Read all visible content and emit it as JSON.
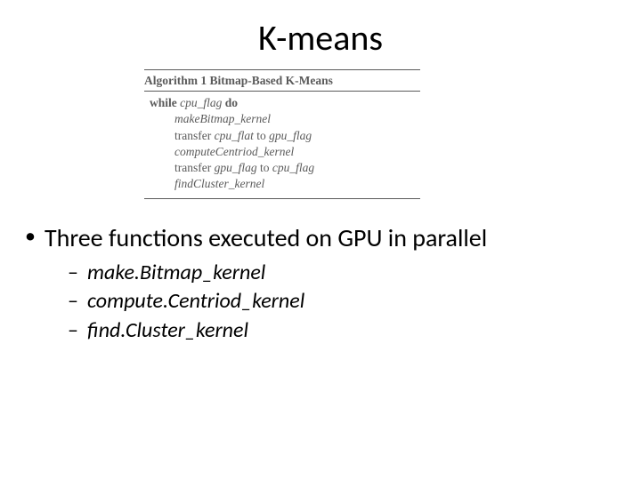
{
  "title": "K-means",
  "algorithm": {
    "header_label": "Algorithm 1",
    "header_desc": "Bitmap-Based K-Means",
    "while_kw": "while",
    "while_cond": "cpu_flag",
    "do_kw": "do",
    "line1": "makeBitmap_kernel",
    "line2_a": "transfer ",
    "line2_b": "cpu_flat",
    "line2_c": " to ",
    "line2_d": "gpu_flag",
    "line3": "computeCentriod_kernel",
    "line4_a": "transfer ",
    "line4_b": "gpu_flag",
    "line4_c": " to ",
    "line4_d": "cpu_flag",
    "line5": "findCluster_kernel"
  },
  "bullet_main": "Three functions executed on GPU in parallel",
  "sub_bullets": {
    "b1": "make.Bitmap_kernel",
    "b2": "compute.Centriod_kernel",
    "b3": "find.Cluster_kernel"
  }
}
